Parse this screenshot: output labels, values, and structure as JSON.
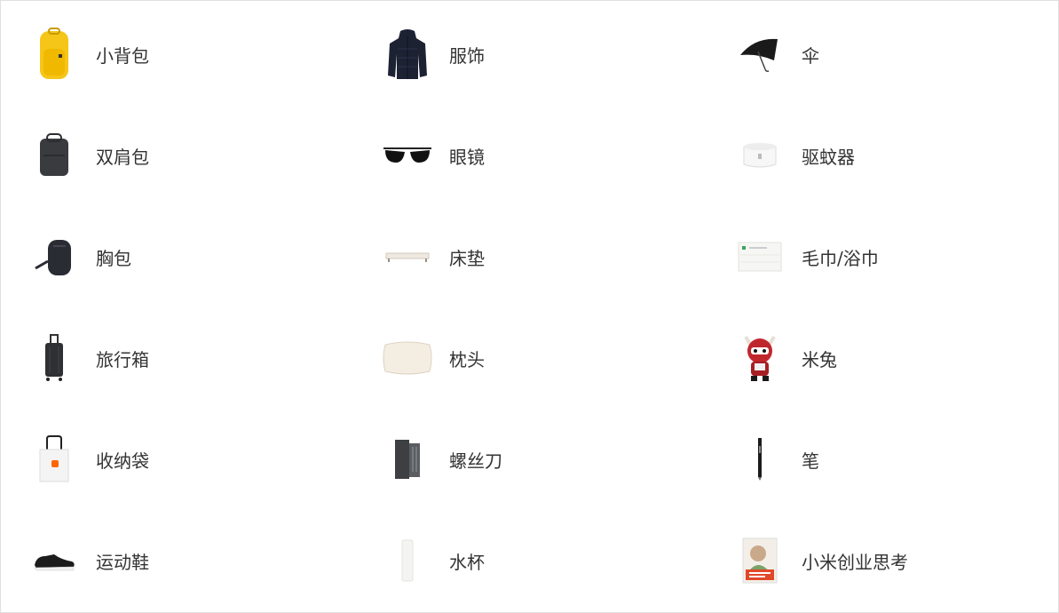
{
  "category_menu": {
    "columns": [
      {
        "items": [
          {
            "label": "小背包",
            "icon": "yellow-backpack-icon"
          },
          {
            "label": "双肩包",
            "icon": "dark-backpack-icon"
          },
          {
            "label": "胸包",
            "icon": "chest-bag-icon"
          },
          {
            "label": "旅行箱",
            "icon": "suitcase-icon"
          },
          {
            "label": "收纳袋",
            "icon": "tote-bag-icon"
          },
          {
            "label": "运动鞋",
            "icon": "sneaker-icon"
          }
        ]
      },
      {
        "items": [
          {
            "label": "服饰",
            "icon": "down-jacket-icon"
          },
          {
            "label": "眼镜",
            "icon": "sunglasses-icon"
          },
          {
            "label": "床垫",
            "icon": "mattress-icon"
          },
          {
            "label": "枕头",
            "icon": "pillow-icon"
          },
          {
            "label": "螺丝刀",
            "icon": "screwdriver-kit-icon"
          },
          {
            "label": "水杯",
            "icon": "water-bottle-icon"
          }
        ]
      },
      {
        "items": [
          {
            "label": "伞",
            "icon": "umbrella-icon"
          },
          {
            "label": "驱蚊器",
            "icon": "mosquito-repeller-icon"
          },
          {
            "label": "毛巾/浴巾",
            "icon": "towel-icon"
          },
          {
            "label": "米兔",
            "icon": "mitu-bunny-icon"
          },
          {
            "label": "笔",
            "icon": "pen-icon"
          },
          {
            "label": "小米创业思考",
            "icon": "book-icon"
          }
        ]
      }
    ]
  }
}
